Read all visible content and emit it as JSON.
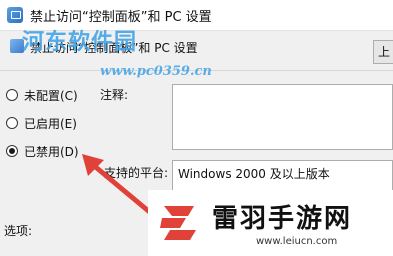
{
  "window": {
    "title": "禁止访问“控制面板”和 PC 设置",
    "icon": "control-panel-icon"
  },
  "header": {
    "title": "禁止访问“控制面板”和 PC 设置",
    "prev_button": "上"
  },
  "options": [
    {
      "label": "未配置(C)",
      "checked": false
    },
    {
      "label": "已启用(E)",
      "checked": false
    },
    {
      "label": "已禁用(D)",
      "checked": true
    }
  ],
  "fields": {
    "comment_label": "注释:",
    "comment_value": "",
    "platform_label": "支持的平台:",
    "platform_value": "Windows 2000 及以上版本",
    "options_label": "选项:"
  },
  "watermarks": {
    "top_text": "河东软件园",
    "top_url": "www.pc0359.cn",
    "brand_name": "雷羽手游网",
    "brand_url": "www.leiucn.com",
    "accent_color": "#3fa2e6",
    "arrow_color": "#e0423a"
  }
}
